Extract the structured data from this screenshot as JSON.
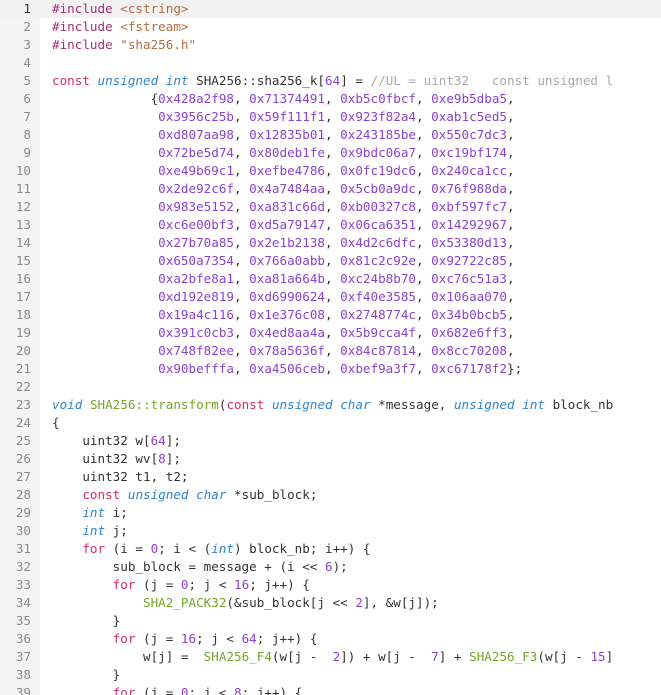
{
  "editor": {
    "current_line": "1",
    "lines": [
      {
        "n": "1",
        "t": [
          [
            "pp",
            "#include"
          ],
          [
            "id",
            " "
          ],
          [
            "inc",
            "<cstring>"
          ]
        ]
      },
      {
        "n": "2",
        "t": [
          [
            "pp",
            "#include"
          ],
          [
            "id",
            " "
          ],
          [
            "inc",
            "<fstream>"
          ]
        ]
      },
      {
        "n": "3",
        "t": [
          [
            "pp",
            "#include"
          ],
          [
            "id",
            " "
          ],
          [
            "inc",
            "\"sha256.h\""
          ]
        ]
      },
      {
        "n": "4",
        "t": []
      },
      {
        "n": "5",
        "t": [
          [
            "kw",
            "const"
          ],
          [
            "id",
            " "
          ],
          [
            "ty",
            "unsigned"
          ],
          [
            "id",
            " "
          ],
          [
            "ty",
            "int"
          ],
          [
            "id",
            " SHA256::sha256_k["
          ],
          [
            "num",
            "64"
          ],
          [
            "id",
            "] = "
          ],
          [
            "cm",
            "//UL = uint32   const unsigned l"
          ]
        ]
      },
      {
        "n": "6",
        "t": [
          [
            "id",
            "             {"
          ],
          [
            "num",
            "0x428a2f98"
          ],
          [
            "id",
            ", "
          ],
          [
            "num",
            "0x71374491"
          ],
          [
            "id",
            ", "
          ],
          [
            "num",
            "0xb5c0fbcf"
          ],
          [
            "id",
            ", "
          ],
          [
            "num",
            "0xe9b5dba5"
          ],
          [
            "id",
            ","
          ]
        ]
      },
      {
        "n": "7",
        "t": [
          [
            "id",
            "              "
          ],
          [
            "num",
            "0x3956c25b"
          ],
          [
            "id",
            ", "
          ],
          [
            "num",
            "0x59f111f1"
          ],
          [
            "id",
            ", "
          ],
          [
            "num",
            "0x923f82a4"
          ],
          [
            "id",
            ", "
          ],
          [
            "num",
            "0xab1c5ed5"
          ],
          [
            "id",
            ","
          ]
        ]
      },
      {
        "n": "8",
        "t": [
          [
            "id",
            "              "
          ],
          [
            "num",
            "0xd807aa98"
          ],
          [
            "id",
            ", "
          ],
          [
            "num",
            "0x12835b01"
          ],
          [
            "id",
            ", "
          ],
          [
            "num",
            "0x243185be"
          ],
          [
            "id",
            ", "
          ],
          [
            "num",
            "0x550c7dc3"
          ],
          [
            "id",
            ","
          ]
        ]
      },
      {
        "n": "9",
        "t": [
          [
            "id",
            "              "
          ],
          [
            "num",
            "0x72be5d74"
          ],
          [
            "id",
            ", "
          ],
          [
            "num",
            "0x80deb1fe"
          ],
          [
            "id",
            ", "
          ],
          [
            "num",
            "0x9bdc06a7"
          ],
          [
            "id",
            ", "
          ],
          [
            "num",
            "0xc19bf174"
          ],
          [
            "id",
            ","
          ]
        ]
      },
      {
        "n": "10",
        "t": [
          [
            "id",
            "              "
          ],
          [
            "num",
            "0xe49b69c1"
          ],
          [
            "id",
            ", "
          ],
          [
            "num",
            "0xefbe4786"
          ],
          [
            "id",
            ", "
          ],
          [
            "num",
            "0x0fc19dc6"
          ],
          [
            "id",
            ", "
          ],
          [
            "num",
            "0x240ca1cc"
          ],
          [
            "id",
            ","
          ]
        ]
      },
      {
        "n": "11",
        "t": [
          [
            "id",
            "              "
          ],
          [
            "num",
            "0x2de92c6f"
          ],
          [
            "id",
            ", "
          ],
          [
            "num",
            "0x4a7484aa"
          ],
          [
            "id",
            ", "
          ],
          [
            "num",
            "0x5cb0a9dc"
          ],
          [
            "id",
            ", "
          ],
          [
            "num",
            "0x76f988da"
          ],
          [
            "id",
            ","
          ]
        ]
      },
      {
        "n": "12",
        "t": [
          [
            "id",
            "              "
          ],
          [
            "num",
            "0x983e5152"
          ],
          [
            "id",
            ", "
          ],
          [
            "num",
            "0xa831c66d"
          ],
          [
            "id",
            ", "
          ],
          [
            "num",
            "0xb00327c8"
          ],
          [
            "id",
            ", "
          ],
          [
            "num",
            "0xbf597fc7"
          ],
          [
            "id",
            ","
          ]
        ]
      },
      {
        "n": "13",
        "t": [
          [
            "id",
            "              "
          ],
          [
            "num",
            "0xc6e00bf3"
          ],
          [
            "id",
            ", "
          ],
          [
            "num",
            "0xd5a79147"
          ],
          [
            "id",
            ", "
          ],
          [
            "num",
            "0x06ca6351"
          ],
          [
            "id",
            ", "
          ],
          [
            "num",
            "0x14292967"
          ],
          [
            "id",
            ","
          ]
        ]
      },
      {
        "n": "14",
        "t": [
          [
            "id",
            "              "
          ],
          [
            "num",
            "0x27b70a85"
          ],
          [
            "id",
            ", "
          ],
          [
            "num",
            "0x2e1b2138"
          ],
          [
            "id",
            ", "
          ],
          [
            "num",
            "0x4d2c6dfc"
          ],
          [
            "id",
            ", "
          ],
          [
            "num",
            "0x53380d13"
          ],
          [
            "id",
            ","
          ]
        ]
      },
      {
        "n": "15",
        "t": [
          [
            "id",
            "              "
          ],
          [
            "num",
            "0x650a7354"
          ],
          [
            "id",
            ", "
          ],
          [
            "num",
            "0x766a0abb"
          ],
          [
            "id",
            ", "
          ],
          [
            "num",
            "0x81c2c92e"
          ],
          [
            "id",
            ", "
          ],
          [
            "num",
            "0x92722c85"
          ],
          [
            "id",
            ","
          ]
        ]
      },
      {
        "n": "16",
        "t": [
          [
            "id",
            "              "
          ],
          [
            "num",
            "0xa2bfe8a1"
          ],
          [
            "id",
            ", "
          ],
          [
            "num",
            "0xa81a664b"
          ],
          [
            "id",
            ", "
          ],
          [
            "num",
            "0xc24b8b70"
          ],
          [
            "id",
            ", "
          ],
          [
            "num",
            "0xc76c51a3"
          ],
          [
            "id",
            ","
          ]
        ]
      },
      {
        "n": "17",
        "t": [
          [
            "id",
            "              "
          ],
          [
            "num",
            "0xd192e819"
          ],
          [
            "id",
            ", "
          ],
          [
            "num",
            "0xd6990624"
          ],
          [
            "id",
            ", "
          ],
          [
            "num",
            "0xf40e3585"
          ],
          [
            "id",
            ", "
          ],
          [
            "num",
            "0x106aa070"
          ],
          [
            "id",
            ","
          ]
        ]
      },
      {
        "n": "18",
        "t": [
          [
            "id",
            "              "
          ],
          [
            "num",
            "0x19a4c116"
          ],
          [
            "id",
            ", "
          ],
          [
            "num",
            "0x1e376c08"
          ],
          [
            "id",
            ", "
          ],
          [
            "num",
            "0x2748774c"
          ],
          [
            "id",
            ", "
          ],
          [
            "num",
            "0x34b0bcb5"
          ],
          [
            "id",
            ","
          ]
        ]
      },
      {
        "n": "19",
        "t": [
          [
            "id",
            "              "
          ],
          [
            "num",
            "0x391c0cb3"
          ],
          [
            "id",
            ", "
          ],
          [
            "num",
            "0x4ed8aa4a"
          ],
          [
            "id",
            ", "
          ],
          [
            "num",
            "0x5b9cca4f"
          ],
          [
            "id",
            ", "
          ],
          [
            "num",
            "0x682e6ff3"
          ],
          [
            "id",
            ","
          ]
        ]
      },
      {
        "n": "20",
        "t": [
          [
            "id",
            "              "
          ],
          [
            "num",
            "0x748f82ee"
          ],
          [
            "id",
            ", "
          ],
          [
            "num",
            "0x78a5636f"
          ],
          [
            "id",
            ", "
          ],
          [
            "num",
            "0x84c87814"
          ],
          [
            "id",
            ", "
          ],
          [
            "num",
            "0x8cc70208"
          ],
          [
            "id",
            ","
          ]
        ]
      },
      {
        "n": "21",
        "t": [
          [
            "id",
            "              "
          ],
          [
            "num",
            "0x90befffa"
          ],
          [
            "id",
            ", "
          ],
          [
            "num",
            "0xa4506ceb"
          ],
          [
            "id",
            ", "
          ],
          [
            "num",
            "0xbef9a3f7"
          ],
          [
            "id",
            ", "
          ],
          [
            "num",
            "0xc67178f2"
          ],
          [
            "id",
            "};"
          ]
        ]
      },
      {
        "n": "22",
        "t": []
      },
      {
        "n": "23",
        "t": [
          [
            "ty",
            "void"
          ],
          [
            "id",
            " "
          ],
          [
            "fn",
            "SHA256::transform"
          ],
          [
            "id",
            "("
          ],
          [
            "kw",
            "const"
          ],
          [
            "id",
            " "
          ],
          [
            "ty",
            "unsigned"
          ],
          [
            "id",
            " "
          ],
          [
            "ty",
            "char"
          ],
          [
            "id",
            " *message, "
          ],
          [
            "ty",
            "unsigned"
          ],
          [
            "id",
            " "
          ],
          [
            "ty",
            "int"
          ],
          [
            "id",
            " block_nb"
          ]
        ]
      },
      {
        "n": "24",
        "t": [
          [
            "id",
            "{"
          ]
        ]
      },
      {
        "n": "25",
        "t": [
          [
            "id",
            "    uint32 w["
          ],
          [
            "num",
            "64"
          ],
          [
            "id",
            "];"
          ]
        ]
      },
      {
        "n": "26",
        "t": [
          [
            "id",
            "    uint32 wv["
          ],
          [
            "num",
            "8"
          ],
          [
            "id",
            "];"
          ]
        ]
      },
      {
        "n": "27",
        "t": [
          [
            "id",
            "    uint32 t1, t2;"
          ]
        ]
      },
      {
        "n": "28",
        "t": [
          [
            "id",
            "    "
          ],
          [
            "kw",
            "const"
          ],
          [
            "id",
            " "
          ],
          [
            "ty",
            "unsigned"
          ],
          [
            "id",
            " "
          ],
          [
            "ty",
            "char"
          ],
          [
            "id",
            " *sub_block;"
          ]
        ]
      },
      {
        "n": "29",
        "t": [
          [
            "id",
            "    "
          ],
          [
            "ty",
            "int"
          ],
          [
            "id",
            " i;"
          ]
        ]
      },
      {
        "n": "30",
        "t": [
          [
            "id",
            "    "
          ],
          [
            "ty",
            "int"
          ],
          [
            "id",
            " j;"
          ]
        ]
      },
      {
        "n": "31",
        "t": [
          [
            "id",
            "    "
          ],
          [
            "kw",
            "for"
          ],
          [
            "id",
            " (i = "
          ],
          [
            "num",
            "0"
          ],
          [
            "id",
            "; i < ("
          ],
          [
            "ty",
            "int"
          ],
          [
            "id",
            ") block_nb; i++) {"
          ]
        ]
      },
      {
        "n": "32",
        "t": [
          [
            "id",
            "        sub_block = message + (i << "
          ],
          [
            "num",
            "6"
          ],
          [
            "id",
            ");"
          ]
        ]
      },
      {
        "n": "33",
        "t": [
          [
            "id",
            "        "
          ],
          [
            "kw",
            "for"
          ],
          [
            "id",
            " (j = "
          ],
          [
            "num",
            "0"
          ],
          [
            "id",
            "; j < "
          ],
          [
            "num",
            "16"
          ],
          [
            "id",
            "; j++) {"
          ]
        ]
      },
      {
        "n": "34",
        "t": [
          [
            "id",
            "            "
          ],
          [
            "fn",
            "SHA2_PACK32"
          ],
          [
            "id",
            "(&sub_block[j << "
          ],
          [
            "num",
            "2"
          ],
          [
            "id",
            "], &w[j]);"
          ]
        ]
      },
      {
        "n": "35",
        "t": [
          [
            "id",
            "        }"
          ]
        ]
      },
      {
        "n": "36",
        "t": [
          [
            "id",
            "        "
          ],
          [
            "kw",
            "for"
          ],
          [
            "id",
            " (j = "
          ],
          [
            "num",
            "16"
          ],
          [
            "id",
            "; j < "
          ],
          [
            "num",
            "64"
          ],
          [
            "id",
            "; j++) {"
          ]
        ]
      },
      {
        "n": "37",
        "t": [
          [
            "id",
            "            w[j] =  "
          ],
          [
            "fn",
            "SHA256_F4"
          ],
          [
            "id",
            "(w[j -  "
          ],
          [
            "num",
            "2"
          ],
          [
            "id",
            "]) + w[j -  "
          ],
          [
            "num",
            "7"
          ],
          [
            "id",
            "] + "
          ],
          [
            "fn",
            "SHA256_F3"
          ],
          [
            "id",
            "(w[j - "
          ],
          [
            "num",
            "15"
          ],
          [
            "id",
            "]"
          ]
        ]
      },
      {
        "n": "38",
        "t": [
          [
            "id",
            "        }"
          ]
        ]
      },
      {
        "n": "39",
        "t": [
          [
            "id",
            "        "
          ],
          [
            "kw",
            "for"
          ],
          [
            "id",
            " (j = "
          ],
          [
            "num",
            "0"
          ],
          [
            "id",
            "; j < "
          ],
          [
            "num",
            "8"
          ],
          [
            "id",
            "; j++) {"
          ]
        ]
      }
    ]
  }
}
